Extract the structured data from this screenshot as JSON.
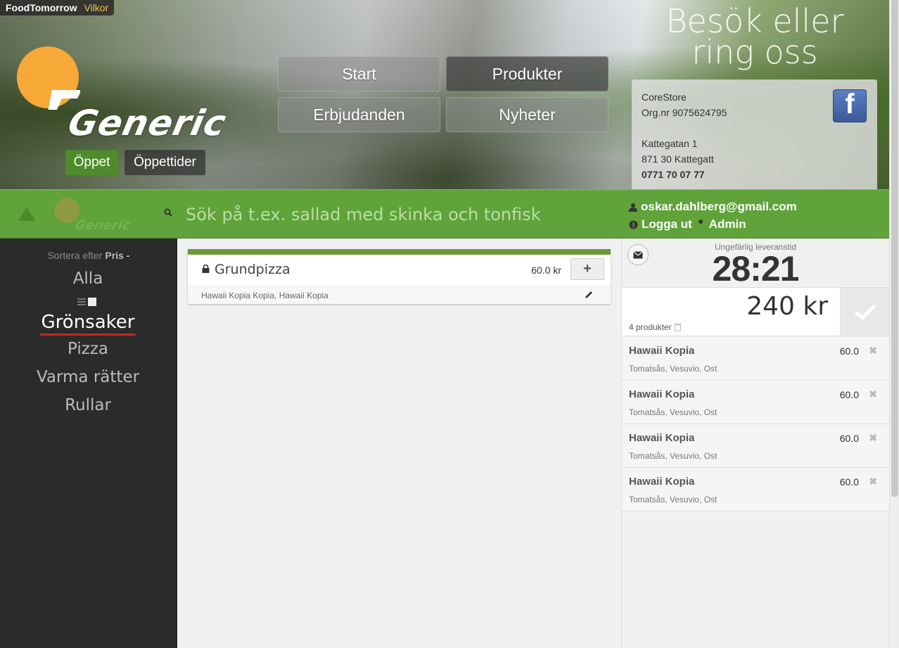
{
  "topbar": {
    "brand": "FoodTomorrow",
    "terms_link": "Vilkor"
  },
  "header": {
    "logo_text": "Generic",
    "open_button": "Öppet",
    "hours_button": "Öppettider",
    "nav": [
      {
        "label": "Start",
        "active": false
      },
      {
        "label": "Produkter",
        "active": true
      },
      {
        "label": "Erbjudanden",
        "active": false
      },
      {
        "label": "Nyheter",
        "active": false
      }
    ],
    "visit_title": "Besök eller ring oss",
    "contact": {
      "company": "CoreStore",
      "org_nr": "Org.nr 9075624795",
      "street": "Kattegatan 1",
      "city": "871 30 Kattegatt",
      "phone": "0771 70 07 77"
    },
    "facebook_glyph": "f"
  },
  "searchbar": {
    "mini_logo_text": "Generic",
    "placeholder": "Sök på t.ex. sallad med skinka och tonfisk",
    "user_email": "oskar.dahlberg@gmail.com",
    "logout_label": "Logga ut",
    "admin_label": "Admin"
  },
  "sidebar": {
    "sort_label": "Sortera efter",
    "sort_value": "Pris -",
    "categories": [
      {
        "label": "Alla",
        "active": false
      },
      {
        "label": "Grönsaker",
        "active": true
      },
      {
        "label": "Pizza",
        "active": false
      },
      {
        "label": "Varma rätter",
        "active": false
      },
      {
        "label": "Rullar",
        "active": false
      }
    ]
  },
  "products": [
    {
      "title": "Grundpizza",
      "price": "60.0 kr",
      "add_label": "+",
      "ingredients": "Hawaii Kopia Kopia,  Hawaii Kopia"
    }
  ],
  "cart": {
    "eta_label": "Ungefärlig leveranstid",
    "eta_time": "28:21",
    "total": "240 kr",
    "products_count": "4 produkter",
    "items": [
      {
        "name": "Hawaii Kopia",
        "price": "60.0",
        "ingredients": "Tomatsås,  Vesuvio,  Ost"
      },
      {
        "name": "Hawaii Kopia",
        "price": "60.0",
        "ingredients": "Tomatsås,  Vesuvio,  Ost"
      },
      {
        "name": "Hawaii Kopia",
        "price": "60.0",
        "ingredients": "Tomatsås,  Vesuvio,  Ost"
      },
      {
        "name": "Hawaii Kopia",
        "price": "60.0",
        "ingredients": "Tomatsås,  Vesuvio,  Ost"
      }
    ],
    "remove_glyph": "✖"
  },
  "colors": {
    "accent_green": "#5fa33a",
    "open_green": "#4d8b2b",
    "logo_orange": "#f7a937",
    "active_underline": "#c0282d",
    "facebook_blue": "#3b5998"
  }
}
